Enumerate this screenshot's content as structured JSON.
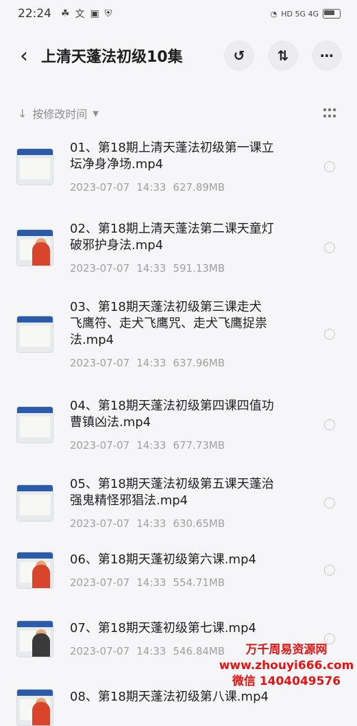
{
  "status_bar": {
    "time": "22:24",
    "left_icons": [
      "clover-icon",
      "translate-icon",
      "translate-box-icon",
      "shield-icon"
    ],
    "right_text": "HD 5G 4G"
  },
  "header": {
    "back_icon": "chevron-left-icon",
    "title": "上清天蓬法初级10集",
    "actions": [
      "history-icon",
      "sort-arrows-icon",
      "more-icon"
    ]
  },
  "sort": {
    "label": "按修改时间",
    "icon": "arrow-down-icon"
  },
  "files": [
    {
      "name": "01、第18期上清天蓬法初级第一课立\n坛净身净场.mp4",
      "date": "2023-07-07",
      "time": "14:33",
      "size": "627.89MB",
      "thumb": "whiteboard"
    },
    {
      "name": "02、第18期上清天蓬法第二课天童灯\n破邪护身法.mp4",
      "date": "2023-07-07",
      "time": "14:33",
      "size": "591.13MB",
      "thumb": "person"
    },
    {
      "name": "03、第18期天蓬法初级第三课走犬\n飞鹰符、走犬飞鹰咒、走犬飞鹰捉祟\n法.mp4",
      "date": "2023-07-07",
      "time": "14:33",
      "size": "637.96MB",
      "thumb": "whiteboard"
    },
    {
      "name": "04、第18期天蓬法初级第四课四值功\n曹镇凶法.mp4",
      "date": "2023-07-07",
      "time": "14:33",
      "size": "677.73MB",
      "thumb": "whiteboard"
    },
    {
      "name": "05、第18期天蓬法初级第五课天蓬治\n强鬼精怪邪猖法.mp4",
      "date": "2023-07-07",
      "time": "14:33",
      "size": "630.65MB",
      "thumb": "whiteboard"
    },
    {
      "name": "06、第18期天蓬初级第六课.mp4",
      "date": "2023-07-07",
      "time": "14:33",
      "size": "554.71MB",
      "thumb": "person"
    },
    {
      "name": "07、第18期天蓬初级第七课.mp4",
      "date": "2023-07-07",
      "time": "14:33",
      "size": "546.84MB",
      "thumb": "person-dark"
    },
    {
      "name": "08、第18期天蓬法初级第八课.mp4",
      "date": "",
      "time": "",
      "size": "",
      "thumb": "person"
    }
  ],
  "watermark": {
    "line1": "万千周易资源网",
    "line2": "www.zhouyi666.com",
    "line3": "微信 1404049576"
  }
}
